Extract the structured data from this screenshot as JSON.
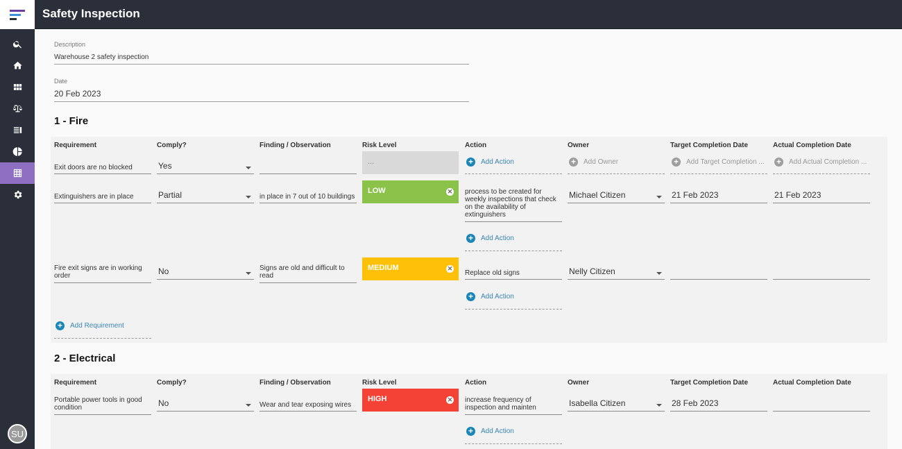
{
  "app": {
    "title": "Safety Inspection"
  },
  "user": {
    "initials": "SU"
  },
  "nav": [
    "search-icon",
    "home-icon",
    "grid-icon",
    "scales-icon",
    "list-icon",
    "pie-chart-icon",
    "table-icon",
    "gear-icon"
  ],
  "form": {
    "description_label": "Description",
    "description_value": "Warehouse 2 safety inspection",
    "date_label": "Date",
    "date_value": "20 Feb 2023"
  },
  "columns": {
    "requirement": "Requirement",
    "comply": "Comply?",
    "finding": "Finding / Observation",
    "risk": "Risk Level",
    "action": "Action",
    "owner": "Owner",
    "target": "Target Completion Date",
    "actual": "Actual Completion Date"
  },
  "labels": {
    "add_action": "Add Action",
    "add_owner": "Add Owner",
    "add_target": "Add Target Completion ...",
    "add_actual": "Add Actual Completion ...",
    "add_requirement": "Add Requirement",
    "risk_empty": "..."
  },
  "colors": {
    "low": "#8bc34a",
    "medium": "#ffc107",
    "high": "#f44336",
    "accent": "#8e6fc1"
  },
  "sections": [
    {
      "title": "1 - Fire",
      "rows": [
        {
          "requirement": "Exit doors are no blocked",
          "comply": "Yes",
          "finding": "",
          "risk": "",
          "action": "",
          "owner": "",
          "target": "",
          "actual": ""
        },
        {
          "requirement": "Extinguishers are in place",
          "comply": "Partial",
          "finding": "in place in 7 out of 10 buildings",
          "risk": "LOW",
          "action": "process to be created for weekly inspections that check on the availability of extinguishers",
          "owner": "Michael Citizen",
          "target": "21 Feb 2023",
          "actual": "21 Feb 2023"
        },
        {
          "requirement": "Fire exit signs are in working order",
          "comply": "No",
          "finding": "Signs are old and difficult to read",
          "risk": "MEDIUM",
          "action": "Replace old signs",
          "owner": "Nelly Citizen",
          "target": "",
          "actual": ""
        }
      ]
    },
    {
      "title": "2 - Electrical",
      "rows": [
        {
          "requirement": "Portable power tools in good condition",
          "comply": "No",
          "finding": "Wear and tear exposing wires",
          "risk": "HIGH",
          "action": "increase frequency of inspection and mainten",
          "owner": "Isabella Citizen",
          "target": "28 Feb 2023",
          "actual": ""
        }
      ]
    }
  ]
}
